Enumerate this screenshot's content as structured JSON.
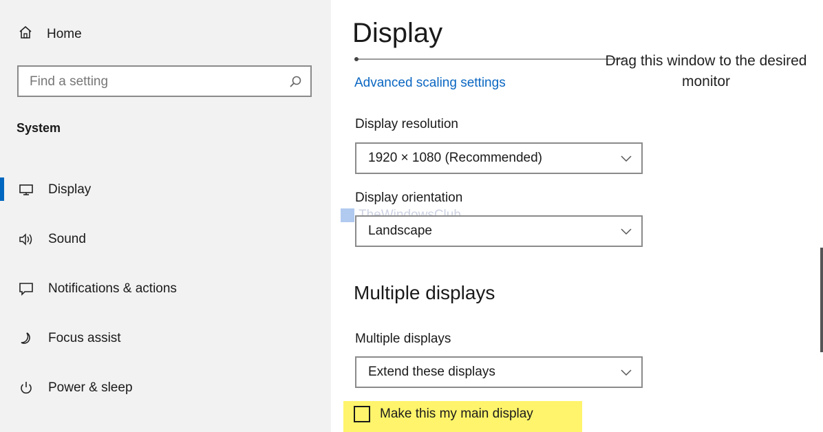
{
  "sidebar": {
    "home_label": "Home",
    "search_placeholder": "Find a setting",
    "group_title": "System",
    "items": [
      {
        "label": "Display",
        "icon": "monitor-icon",
        "active": true
      },
      {
        "label": "Sound",
        "icon": "speaker-icon"
      },
      {
        "label": "Notifications & actions",
        "icon": "notification-icon"
      },
      {
        "label": "Focus assist",
        "icon": "moon-icon"
      },
      {
        "label": "Power & sleep",
        "icon": "power-icon"
      }
    ],
    "accent_color": "#0067c0"
  },
  "main": {
    "title": "Display",
    "advanced_link": "Advanced scaling settings",
    "annotation": "Drag this window to the desired monitor",
    "resolution": {
      "label": "Display resolution",
      "value": "1920 × 1080 (Recommended)"
    },
    "orientation": {
      "label": "Display orientation",
      "value": "Landscape"
    },
    "watermark": "TheWindowsClub",
    "multiple_heading": "Multiple displays",
    "multiple": {
      "label": "Multiple displays",
      "value": "Extend these displays"
    },
    "main_display_checkbox": {
      "label": "Make this my main display",
      "checked": false
    },
    "highlight_color": "#fff46b",
    "link_color": "#0a66c2"
  }
}
